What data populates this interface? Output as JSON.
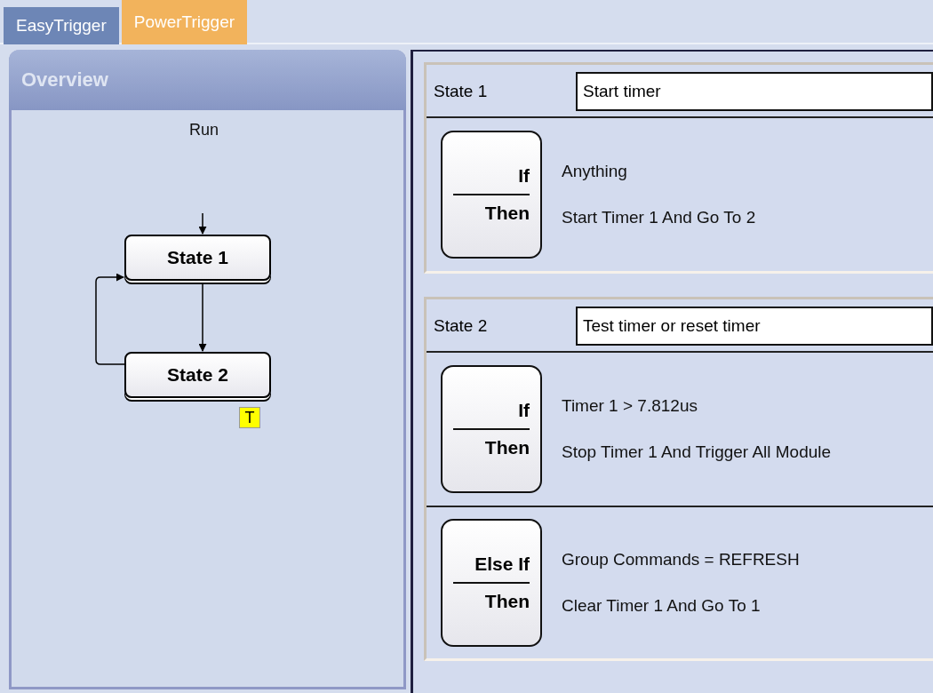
{
  "tabs": [
    {
      "label": "EasyTrigger",
      "selected": false
    },
    {
      "label": "PowerTrigger",
      "selected": true
    }
  ],
  "overview": {
    "title": "Overview",
    "start_label": "Run",
    "nodes": [
      {
        "label": "State 1"
      },
      {
        "label": "State 2",
        "badge": "T"
      }
    ]
  },
  "states": [
    {
      "name": "State 1",
      "description": "Start timer",
      "rules": [
        {
          "condition_keyword": "If",
          "condition": "Anything",
          "action_keyword": "Then",
          "action": "Start Timer 1 And Go To 2"
        }
      ]
    },
    {
      "name": "State 2",
      "description": "Test timer or reset timer",
      "rules": [
        {
          "condition_keyword": "If",
          "condition": "Timer 1 > 7.812us",
          "action_keyword": "Then",
          "action": "Stop Timer 1 And Trigger All Module"
        },
        {
          "condition_keyword": "Else If",
          "condition": "Group Commands = REFRESH",
          "action_keyword": "Then",
          "action": "Clear Timer 1 And Go To 1"
        }
      ]
    }
  ]
}
